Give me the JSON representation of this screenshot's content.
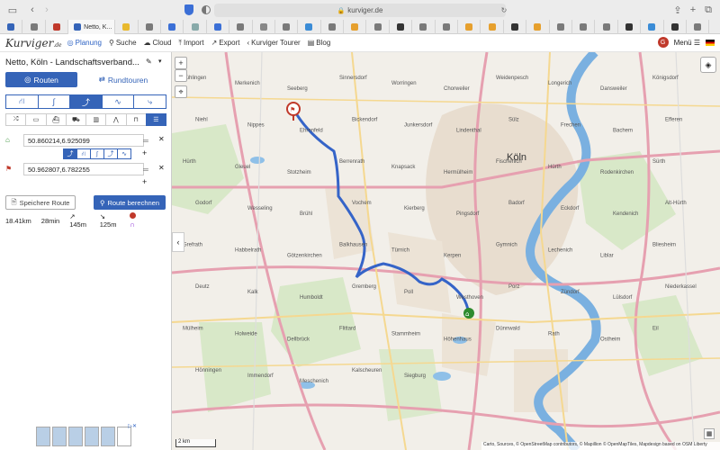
{
  "browser": {
    "url": "kurviger.de",
    "active_tab_label": "Netto, K...",
    "tab_colors": [
      "#3564b8",
      "#7a7a7a",
      "#c0392b",
      "#3564b8",
      "#e8b92e",
      "#7a7a7a",
      "#3b6fd6",
      "#8aa",
      "#3b6fd6",
      "#7a7a7a",
      "#888",
      "#7a7a7a",
      "#3b8cd6",
      "#7a7a7a",
      "#e6a02e",
      "#7a7a7a",
      "#333",
      "#7a7a7a",
      "#7a7a7a",
      "#e6a02e",
      "#e6a02e",
      "#333",
      "#e6a02e",
      "#7a7a7a",
      "#7a7a7a",
      "#7a7a7a",
      "#333",
      "#3b8cd6",
      "#333",
      "#7a7a7a"
    ]
  },
  "nav": {
    "logo": "Kurviger",
    "logo_sub": ".de",
    "items": [
      {
        "label": "Planung",
        "icon": "target-icon"
      },
      {
        "label": "Suche",
        "icon": "search-icon"
      },
      {
        "label": "Cloud",
        "icon": "cloud-icon"
      },
      {
        "label": "Import",
        "icon": "upload-icon"
      },
      {
        "label": "Export",
        "icon": "export-icon"
      },
      {
        "label": "Kurviger Tourer",
        "icon": "tourer-icon"
      },
      {
        "label": "Blog",
        "icon": "blog-icon"
      }
    ],
    "user_initial": "G",
    "menu_label": "Menü"
  },
  "sidebar": {
    "route_title": "Netto, Köln - Landschaftsverband...",
    "tab_routen": "Routen",
    "tab_rundtouren": "Rundtouren",
    "waypoint_start": "50.860214,6.925099",
    "waypoint_end": "50.962807,6.782255",
    "save_label": "Speichere Route",
    "calc_label": "Route berechnen",
    "stats": {
      "distance": "18.41km",
      "duration": "28min",
      "ascent": "↗ 145m",
      "descent": "↘ 125m"
    }
  },
  "map": {
    "city_label": "Köln",
    "place_labels": [
      "Fühlingen",
      "Merkenich",
      "Seeberg",
      "Sinnersdorf",
      "Worringen",
      "Chorweiler",
      "Weidenpesch",
      "Longerich",
      "Dansweiler",
      "Königsdorf",
      "Niehl",
      "Nippes",
      "Ehrenfeld",
      "Bickendorf",
      "Junkersdorf",
      "Lindenthal",
      "Sülz",
      "Frechen",
      "Bachem",
      "Efferen",
      "Hürth",
      "Gleuel",
      "Stotzheim",
      "Berrenrath",
      "Knapsack",
      "Hermülheim",
      "Fischenich",
      "Hürth",
      "Rodenkirchen",
      "Sürth",
      "Godorf",
      "Wesseling",
      "Brühl",
      "Vochem",
      "Kierberg",
      "Pingsdorf",
      "Badorf",
      "Eckdorf",
      "Kendenich",
      "Alt-Hürth",
      "Grefrath",
      "Habbelrath",
      "Götzenkirchen",
      "Balkhausen",
      "Türnich",
      "Kerpen",
      "Gymnich",
      "Lechenich",
      "Liblar",
      "Bliesheim",
      "Deutz",
      "Kalk",
      "Humboldt",
      "Gremberg",
      "Poll",
      "Westhoven",
      "Porz",
      "Zündorf",
      "Lülsdorf",
      "Niederkassel",
      "Mülheim",
      "Holweide",
      "Dellbrück",
      "Flittard",
      "Stammheim",
      "Höhenhaus",
      "Dünnwald",
      "Rath",
      "Ostheim",
      "Eil",
      "Hönningen",
      "Immendorf",
      "Meschenich",
      "Kalscheuren",
      "Siegburg"
    ],
    "scale_label": "2 km",
    "attribution": "Carto, Sources, © OpenStreetMap contributors, © Mapillion © OpenMapTiles, Mapdesign based on OSM Liberty"
  }
}
